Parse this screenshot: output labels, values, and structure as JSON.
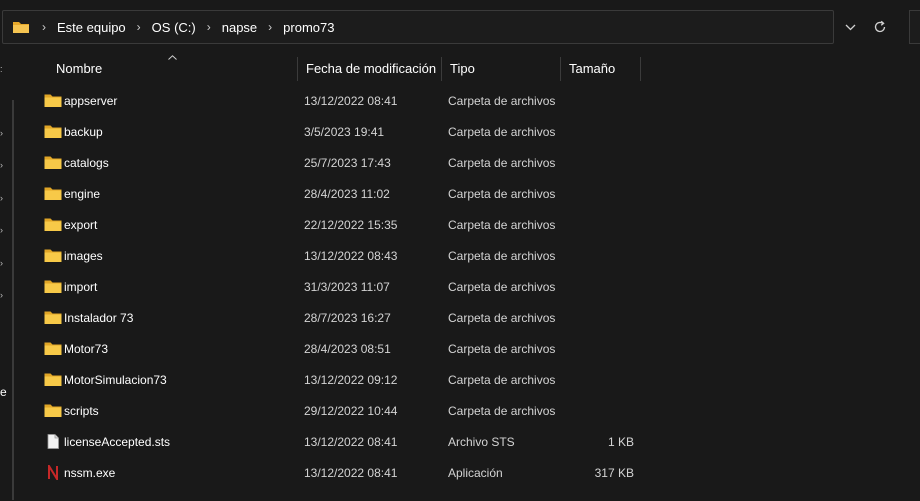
{
  "breadcrumb": {
    "items": [
      "Este equipo",
      "OS (C:)",
      "napse",
      "promo73"
    ],
    "separator": "›"
  },
  "addressbar": {
    "dropdown_icon": "chevron-down-icon",
    "refresh_icon": "refresh-icon"
  },
  "nav": {
    "partial_label": "e"
  },
  "columns": [
    "Nombre",
    "Fecha de modificación",
    "Tipo",
    "Tamaño"
  ],
  "files": [
    {
      "name": "appserver",
      "date": "13/12/2022 08:41",
      "type": "Carpeta de archivos",
      "size": "",
      "icon": "folder-icon"
    },
    {
      "name": "backup",
      "date": "3/5/2023 19:41",
      "type": "Carpeta de archivos",
      "size": "",
      "icon": "folder-icon"
    },
    {
      "name": "catalogs",
      "date": "25/7/2023 17:43",
      "type": "Carpeta de archivos",
      "size": "",
      "icon": "folder-icon"
    },
    {
      "name": "engine",
      "date": "28/4/2023 11:02",
      "type": "Carpeta de archivos",
      "size": "",
      "icon": "folder-icon"
    },
    {
      "name": "export",
      "date": "22/12/2022 15:35",
      "type": "Carpeta de archivos",
      "size": "",
      "icon": "folder-icon"
    },
    {
      "name": "images",
      "date": "13/12/2022 08:43",
      "type": "Carpeta de archivos",
      "size": "",
      "icon": "folder-icon"
    },
    {
      "name": "import",
      "date": "31/3/2023 11:07",
      "type": "Carpeta de archivos",
      "size": "",
      "icon": "folder-icon"
    },
    {
      "name": "Instalador 73",
      "date": "28/7/2023 16:27",
      "type": "Carpeta de archivos",
      "size": "",
      "icon": "folder-icon"
    },
    {
      "name": "Motor73",
      "date": "28/4/2023 08:51",
      "type": "Carpeta de archivos",
      "size": "",
      "icon": "folder-icon"
    },
    {
      "name": "MotorSimulacion73",
      "date": "13/12/2022 09:12",
      "type": "Carpeta de archivos",
      "size": "",
      "icon": "folder-icon"
    },
    {
      "name": "scripts",
      "date": "29/12/2022 10:44",
      "type": "Carpeta de archivos",
      "size": "",
      "icon": "folder-icon"
    },
    {
      "name": "licenseAccepted.sts",
      "date": "13/12/2022 08:41",
      "type": "Archivo STS",
      "size": "1 KB",
      "icon": "file-icon"
    },
    {
      "name": "nssm.exe",
      "date": "13/12/2022 08:41",
      "type": "Aplicación",
      "size": "317 KB",
      "icon": "exe-icon"
    }
  ],
  "colors": {
    "background": "#191919",
    "folder": "#f5c451",
    "exe_accent": "#c62828"
  }
}
